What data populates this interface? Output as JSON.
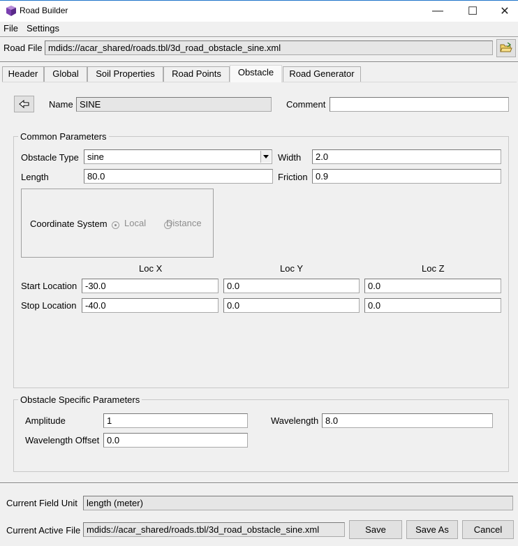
{
  "window": {
    "title": "Road Builder",
    "minimize_glyph": "—",
    "maximize_glyph": "☐",
    "close_glyph": "✕"
  },
  "menu": {
    "file": "File",
    "settings": "Settings"
  },
  "road_file": {
    "label": "Road File",
    "value": "mdids://acar_shared/roads.tbl/3d_road_obstacle_sine.xml",
    "browse_icon": "open-folder-icon"
  },
  "tabs": [
    {
      "label": "Header"
    },
    {
      "label": "Global"
    },
    {
      "label": "Soil Properties"
    },
    {
      "label": "Road Points"
    },
    {
      "label": "Obstacle"
    },
    {
      "label": "Road Generator"
    }
  ],
  "obstacle": {
    "back_icon": "arrow-left-icon",
    "name_label": "Name",
    "name_value": "SINE",
    "comment_label": "Comment",
    "comment_value": ""
  },
  "common": {
    "title": "Common Parameters",
    "type_label": "Obstacle Type",
    "type_value": "sine",
    "width_label": "Width",
    "width_value": "2.0",
    "length_label": "Length",
    "length_value": "80.0",
    "friction_label": "Friction",
    "friction_value": "0.9",
    "coord_label": "Coordinate System",
    "coord_local": "Local",
    "coord_distance": "Distance",
    "loc_x": "Loc X",
    "loc_y": "Loc Y",
    "loc_z": "Loc Z",
    "start_label": "Start Location",
    "start_x": "-30.0",
    "start_y": "0.0",
    "start_z": "0.0",
    "stop_label": "Stop Location",
    "stop_x": "-40.0",
    "stop_y": "0.0",
    "stop_z": "0.0"
  },
  "specific": {
    "title": "Obstacle Specific Parameters",
    "amplitude_label": "Amplitude",
    "amplitude_value": "1",
    "wavelength_label": "Wavelength",
    "wavelength_value": "8.0",
    "offset_label": "Wavelength Offset",
    "offset_value": "0.0"
  },
  "footer": {
    "unit_label": "Current Field Unit",
    "unit_value": "length (meter)",
    "active_label": "Current Active File",
    "active_value": "mdids://acar_shared/roads.tbl/3d_road_obstacle_sine.xml",
    "save": "Save",
    "save_as": "Save As",
    "cancel": "Cancel"
  },
  "colors": {
    "accent": "#1e74c9",
    "window_bg": "#f0f0f0",
    "readonly_bg": "#e6e6e6"
  }
}
